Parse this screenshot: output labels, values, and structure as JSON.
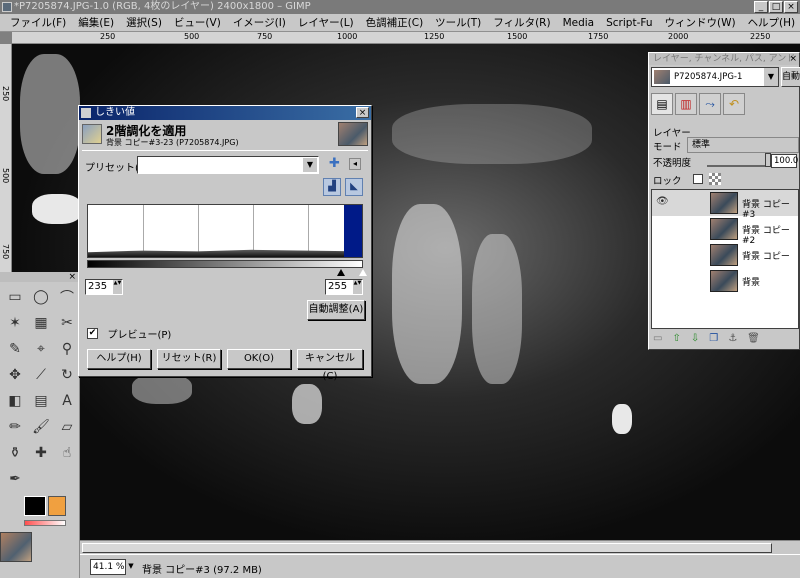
{
  "window": {
    "title": "*P7205874.JPG-1.0 (RGB, 4枚のレイヤー) 2400x1800 – GIMP",
    "min_glyph": "_",
    "max_glyph": "□",
    "close_glyph": "×"
  },
  "menubar": [
    "ファイル(F)",
    "編集(E)",
    "選択(S)",
    "ビュー(V)",
    "イメージ(I)",
    "レイヤー(L)",
    "色調補正(C)",
    "ツール(T)",
    "フィルタ(R)",
    "Media",
    "Script-Fu",
    "ウィンドウ(W)",
    "ヘルプ(H)"
  ],
  "ruler": {
    "top": [
      "250",
      "500",
      "750",
      "1000",
      "1250",
      "1500",
      "1750",
      "2000",
      "2250"
    ],
    "left": [
      "250",
      "500",
      "750"
    ]
  },
  "threshold_dialog": {
    "title": "しきい値",
    "heading": "2階調化を適用",
    "subheading": "背景 コピー#3-23 (P7205874.JPG)",
    "preset_label": "プリセット(S):",
    "preset_value": "",
    "low": "235",
    "high": "255",
    "low_value": 235,
    "high_value": 255,
    "auto_button": "自動調整(A)",
    "preview_label": "プレビュー(P)",
    "preview_checked": true,
    "buttons": {
      "help": "ヘルプ(H)",
      "reset": "リセット(R)",
      "ok": "OK(O)",
      "cancel": "キャンセル(C)"
    }
  },
  "layers_dock": {
    "title": "レイヤー, チャンネル, パス, アンドゥ",
    "image_selector": "P7205874.JPG-1",
    "auto_label": "自動",
    "section_label": "レイヤー",
    "mode_label": "モード",
    "mode_value": "標準",
    "opacity_label": "不透明度",
    "opacity_value": "100.0",
    "opacity_percent": 100,
    "lock_label": "ロック",
    "layers": [
      {
        "name": "背景 コピー#3",
        "visible": true,
        "selected": true
      },
      {
        "name": "背景 コピー#2",
        "visible": false,
        "selected": false
      },
      {
        "name": "背景 コピー",
        "visible": false,
        "selected": false
      },
      {
        "name": "背景",
        "visible": false,
        "selected": false
      }
    ]
  },
  "status": {
    "zoom": "41.1 %",
    "text": "背景 コピー#3 (97.2 MB)"
  },
  "colors": {
    "title_active": "#0a246a",
    "histogram_selection": "#001a88",
    "background_swatch": "#f0a040",
    "foreground_swatch": "#000000"
  }
}
